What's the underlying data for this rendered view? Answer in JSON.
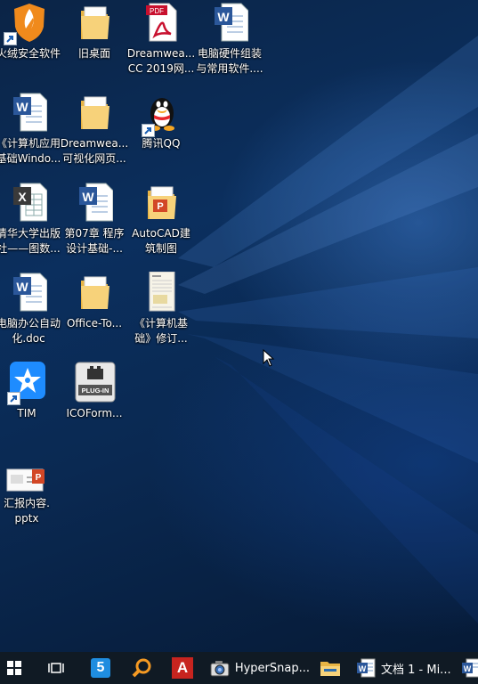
{
  "desktop": {
    "icons": [
      {
        "label_1": "火绒安全软件",
        "label_2": "",
        "icon": "huorong-shield-icon",
        "shortcut": true
      },
      {
        "label_1": "旧桌面",
        "label_2": "",
        "icon": "folder-icon",
        "shortcut": false
      },
      {
        "label_1": "Dreamwea...",
        "label_2": "CC 2019网...",
        "icon": "pdf-file-icon",
        "badge": "PDF",
        "shortcut": false
      },
      {
        "label_1": "电脑硬件组装",
        "label_2": "与常用软件....",
        "icon": "word-doc-icon",
        "shortcut": false
      },
      {
        "label_1": "《计算机应用",
        "label_2": "基础Windo...",
        "icon": "word-doc-icon",
        "shortcut": false
      },
      {
        "label_1": "Dreamwea...",
        "label_2": "可视化网页...",
        "icon": "folder-icon",
        "shortcut": false
      },
      {
        "label_1": "腾讯QQ",
        "label_2": "",
        "icon": "qq-penguin-icon",
        "shortcut": true
      },
      {
        "label_1": "清华大学出版",
        "label_2": "社——图数...",
        "icon": "excel-doc-icon",
        "shortcut": false
      },
      {
        "label_1": "第07章 程序",
        "label_2": "设计基础-...",
        "icon": "word-doc-icon",
        "shortcut": false
      },
      {
        "label_1": "AutoCAD建",
        "label_2": "筑制图",
        "icon": "powerpoint-folder-icon",
        "shortcut": false
      },
      {
        "label_1": "电脑办公自动",
        "label_2": "化.doc",
        "icon": "word-doc-icon",
        "shortcut": false
      },
      {
        "label_1": "Office-To...",
        "label_2": "",
        "icon": "folder-icon",
        "shortcut": false
      },
      {
        "label_1": "《计算机基",
        "label_2": "础》修订...",
        "icon": "document-thumbnail-icon",
        "shortcut": false
      },
      {
        "label_1": "TIM",
        "label_2": "",
        "icon": "tim-star-icon",
        "shortcut": true
      },
      {
        "label_1": "ICOForm...",
        "label_2": "",
        "icon": "plugin-icon",
        "badge": "PLUG-IN",
        "shortcut": false
      },
      {
        "label_1": "汇报内容.",
        "label_2": "pptx",
        "icon": "pptx-thumbnail-icon",
        "shortcut": false
      }
    ]
  },
  "taskbar": {
    "start_icon": "windows-start-icon",
    "task_view_icon": "task-view-icon",
    "pinned": [
      {
        "icon": "app-5-icon",
        "text": "5"
      },
      {
        "icon": "magnifier-app-icon"
      },
      {
        "icon": "autocad-app-icon",
        "text": "A"
      }
    ],
    "windows": [
      {
        "icon": "hypersnap-camera-icon",
        "label": "HyperSnap..."
      },
      {
        "icon": "file-explorer-icon",
        "label": ""
      },
      {
        "icon": "word-app-icon",
        "label": "文档 1 - Mi..."
      },
      {
        "icon": "word-app-icon",
        "label": ""
      }
    ]
  },
  "colors": {
    "taskbar": "#101a24",
    "word_blue": "#2b579a",
    "excel_green": "#217346",
    "pdf_red": "#c8102e",
    "folder_yellow": "#f3c55b"
  }
}
